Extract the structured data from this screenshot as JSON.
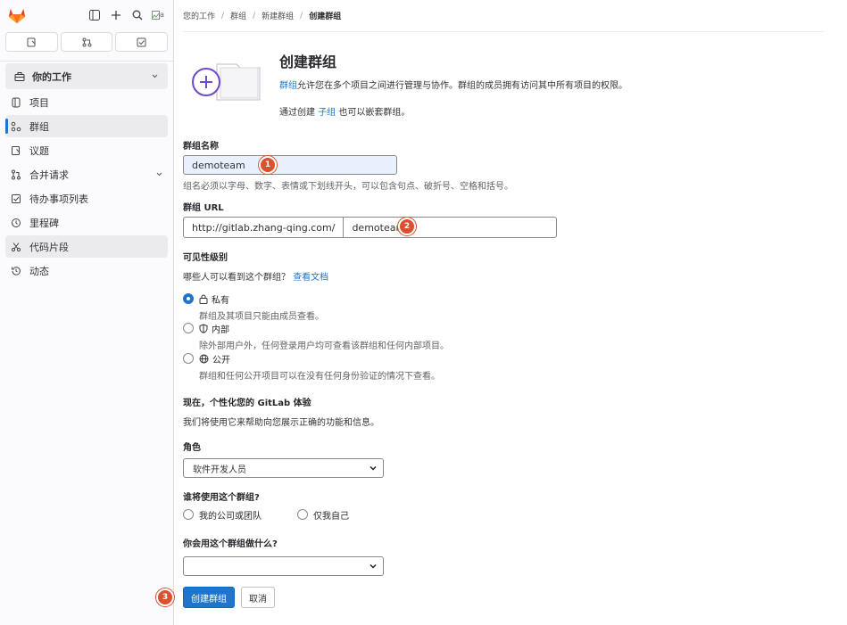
{
  "sidebar": {
    "avatar_alt": "a",
    "section_title": "你的工作",
    "items": [
      {
        "label": "项目",
        "icon": "project-icon"
      },
      {
        "label": "群组",
        "icon": "group-icon"
      },
      {
        "label": "议题",
        "icon": "issues-icon"
      },
      {
        "label": "合并请求",
        "icon": "merge-request-icon"
      },
      {
        "label": "待办事项列表",
        "icon": "todo-icon"
      },
      {
        "label": "里程碑",
        "icon": "milestone-icon"
      },
      {
        "label": "代码片段",
        "icon": "snippet-icon"
      },
      {
        "label": "动态",
        "icon": "history-icon"
      }
    ]
  },
  "breadcrumb": [
    "您的工作",
    "群组",
    "新建群组",
    "创建群组"
  ],
  "hero": {
    "title": "创建群组",
    "desc_link": "群组",
    "desc_rest": "允许您在多个项目之间进行管理与协作。群组的成员拥有访问其中所有项目的权限。",
    "desc2_pre": "通过创建",
    "desc2_link": "子组",
    "desc2_post": "也可以嵌套群组。"
  },
  "form": {
    "name_label": "群组名称",
    "name_value": "demoteam",
    "name_help": "组名必须以字母、数字、表情或下划线开头，可以包含句点、破折号、空格和括号。",
    "url_label": "群组 URL",
    "url_prefix": "http://gitlab.zhang-qing.com/",
    "url_value": "demoteam",
    "visibility_label": "可见性级别",
    "visibility_question": "哪些人可以看到这个群组？",
    "visibility_doc_link": "查看文档",
    "visibility_options": [
      {
        "title": "私有",
        "desc": "群组及其项目只能由成员查看。",
        "checked": true,
        "icon": "lock-icon"
      },
      {
        "title": "内部",
        "desc": "除外部用户外，任何登录用户均可查看该群组和任何内部项目。",
        "checked": false,
        "icon": "shield-icon"
      },
      {
        "title": "公开",
        "desc": "群组和任何公开项目可以在没有任何身份验证的情况下查看。",
        "checked": false,
        "icon": "globe-icon"
      }
    ],
    "personalize_title": "现在，个性化您的 GitLab 体验",
    "personalize_desc": "我们将使用它来帮助向您展示正确的功能和信息。",
    "role_label": "角色",
    "role_value": "软件开发人员",
    "who_label": "谁将使用这个群组?",
    "who_options": [
      "我的公司或团队",
      "仅我自己"
    ],
    "purpose_label": "你会用这个群组做什么?",
    "purpose_value": "",
    "create_button": "创建群组",
    "cancel_button": "取消"
  },
  "annotations": [
    "1",
    "2",
    "3"
  ],
  "colors": {
    "primary": "#1f75cb",
    "badge": "#d9512f",
    "autofill": "#e8f0fe"
  }
}
